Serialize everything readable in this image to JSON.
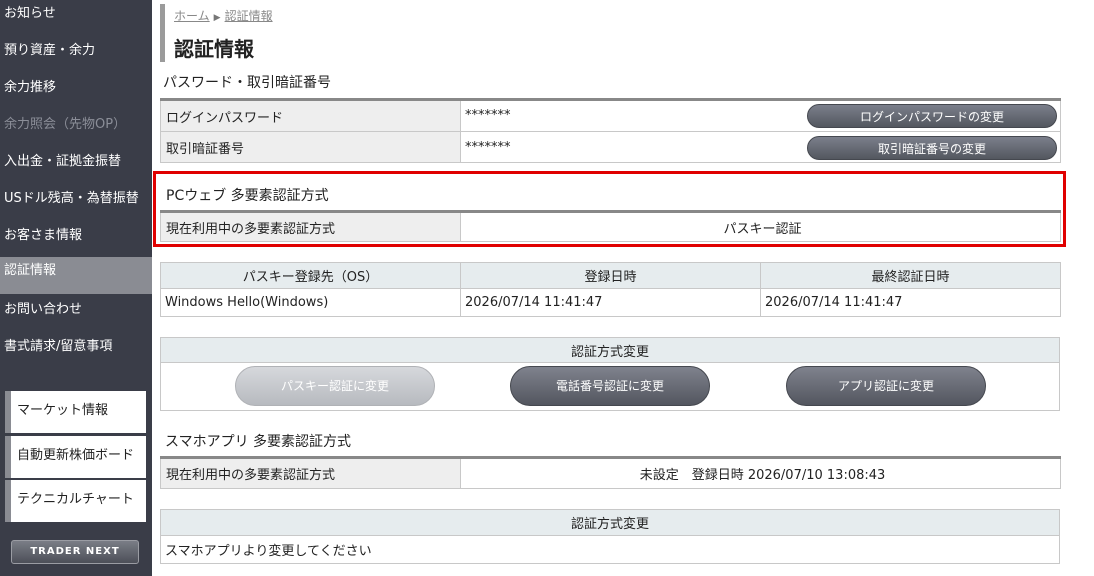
{
  "sidebar": {
    "items": [
      {
        "label": "お知らせ"
      },
      {
        "label": "預り資産・余力"
      },
      {
        "label": "余力推移"
      },
      {
        "label": "余力照会（先物OP）"
      },
      {
        "label": "入出金・証拠金振替"
      },
      {
        "label": "USドル残高・為替振替"
      },
      {
        "label": "お客さま情報"
      },
      {
        "label": "認証情報"
      },
      {
        "label": "お問い合わせ"
      },
      {
        "label": "書式請求/留意事項"
      }
    ],
    "boxes": [
      {
        "label": "マーケット情報"
      },
      {
        "label": "自動更新株価ボード"
      },
      {
        "label": "テクニカルチャート"
      }
    ],
    "trader_next": "TRADER NEXT"
  },
  "breadcrumb": {
    "home": "ホーム",
    "current": "認証情報"
  },
  "page_title": "認証情報",
  "password_section": {
    "title": "パスワード・取引暗証番号",
    "rows": [
      {
        "label": "ログインパスワード",
        "value": "*******",
        "button": "ログインパスワードの変更"
      },
      {
        "label": "取引暗証番号",
        "value": "*******",
        "button": "取引暗証番号の変更"
      }
    ]
  },
  "pc_mfa": {
    "title": "PCウェブ 多要素認証方式",
    "label": "現在利用中の多要素認証方式",
    "value": "パスキー認証"
  },
  "passkey_table": {
    "headers": [
      "パスキー登録先（OS）",
      "登録日時",
      "最終認証日時"
    ],
    "rows": [
      [
        "Windows Hello(Windows)",
        "2026/07/14 11:41:47",
        "2026/07/14 11:41:47"
      ]
    ]
  },
  "change_method": {
    "header": "認証方式変更",
    "buttons": [
      "パスキー認証に変更",
      "電話番号認証に変更",
      "アプリ認証に変更"
    ]
  },
  "app_mfa": {
    "title": "スマホアプリ 多要素認証方式",
    "label": "現在利用中の多要素認証方式",
    "value": "未設定　登録日時 2026/07/10 13:08:43"
  },
  "app_change": {
    "header": "認証方式変更",
    "message": "スマホアプリより変更してください"
  }
}
